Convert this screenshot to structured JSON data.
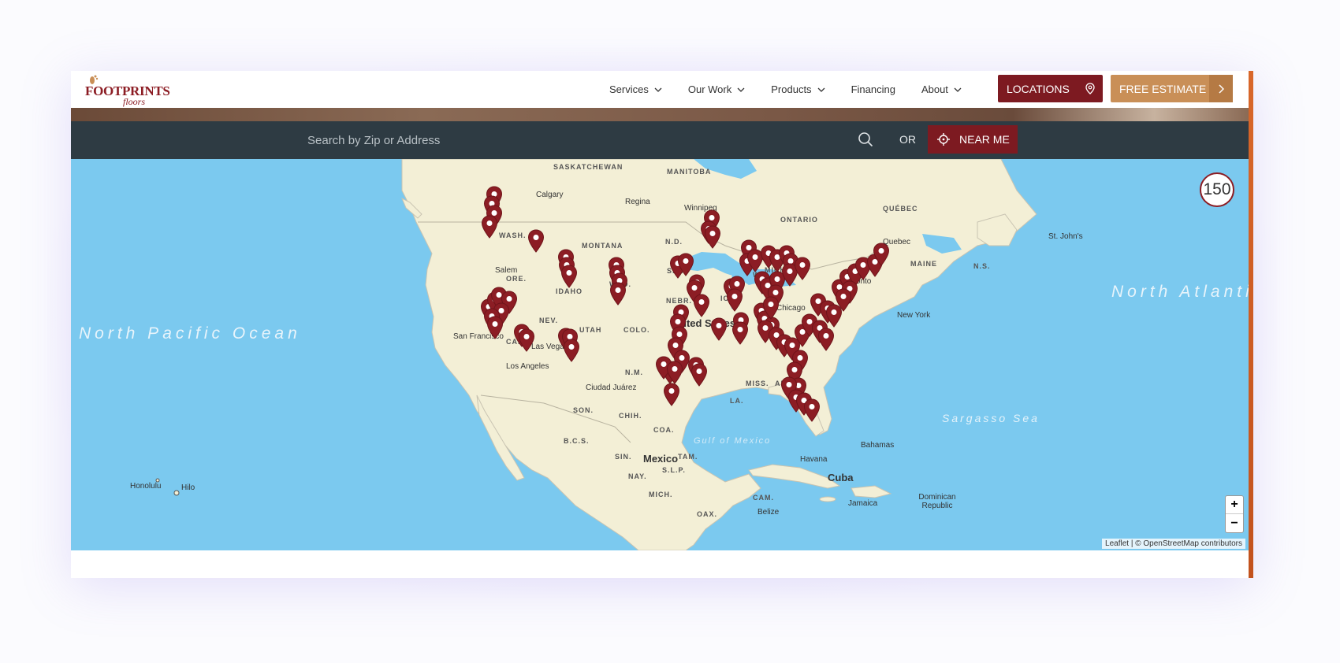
{
  "brand": {
    "name_top": "FOOTPRINTS",
    "name_bottom": "floors",
    "color": "#8c1d24"
  },
  "nav": [
    {
      "label": "Services",
      "dropdown": true
    },
    {
      "label": "Our Work",
      "dropdown": true
    },
    {
      "label": "Products",
      "dropdown": true
    },
    {
      "label": "Financing",
      "dropdown": false
    },
    {
      "label": "About",
      "dropdown": true
    }
  ],
  "buttons": {
    "locations": "LOCATIONS",
    "free_estimate": "FREE ESTIMATE",
    "near_me": "NEAR ME",
    "or": "OR"
  },
  "search": {
    "placeholder": "Search by Zip or Address"
  },
  "map": {
    "cluster_count": "150",
    "zoom_in": "+",
    "zoom_out": "−",
    "attribution": "Leaflet | © OpenStreetMap contributors",
    "oceans": [
      "North Pacific Ocean",
      "North Atlantic Ocean"
    ],
    "seas": [
      "Sargasso Sea",
      "Gulf of Mexico"
    ],
    "labels": {
      "saskatchewan": "SASKATCHEWAN",
      "manitoba": "MANITOBA",
      "ontario": "ONTARIO",
      "quebec": "QUÉBEC",
      "calgary": "Calgary",
      "regina": "Regina",
      "winnipeg": "Winnipeg",
      "quebec_city": "Quebec",
      "st_johns": "St. John's",
      "wash": "WASH.",
      "montana": "MONTANA",
      "nd": "N.D.",
      "sd": "S.D.",
      "mich": "MICH.",
      "maine": "MAINE",
      "ns": "N.S.",
      "ore": "ORE.",
      "idaho": "IDAHO",
      "wyo": "WYO.",
      "nebr": "NEBR.",
      "iowa": "IOWA",
      "wis": "WIS.",
      "salem": "Salem",
      "toronto": "Toronto",
      "new_york": "New York",
      "chicago": "Chicago",
      "nev": "NEV.",
      "utah": "UTAH",
      "colo": "COLO.",
      "united_states": "United States",
      "san_francisco": "San Francisco",
      "calif": "CALIF.",
      "las_vegas": "Las Vegas",
      "los_angeles": "Los Angeles",
      "nm": "N.M.",
      "miss": "MISS.",
      "ala": "ALA.",
      "la": "LA.",
      "ciudad_juarez": "Ciudad Juárez",
      "son": "SON.",
      "chih": "CHIH.",
      "coa": "COA.",
      "bcs": "B.C.S.",
      "sin": "SIN.",
      "mexico": "Mexico",
      "tam": "TAM.",
      "slp": "S.L.P.",
      "nay": "NAY.",
      "mich_mx": "MICH.",
      "oax": "OAX.",
      "cam": "CAM.",
      "belize": "Belize",
      "havana": "Havana",
      "cuba": "Cuba",
      "bahamas": "Bahamas",
      "jamaica": "Jamaica",
      "dominican_republic": "Dominican Republic",
      "honolulu": "Honolulu",
      "hilo": "Hilo"
    },
    "pin_color": "#8c1d24",
    "water_color": "#7bc9ef",
    "land_color": "#f3efd6"
  }
}
